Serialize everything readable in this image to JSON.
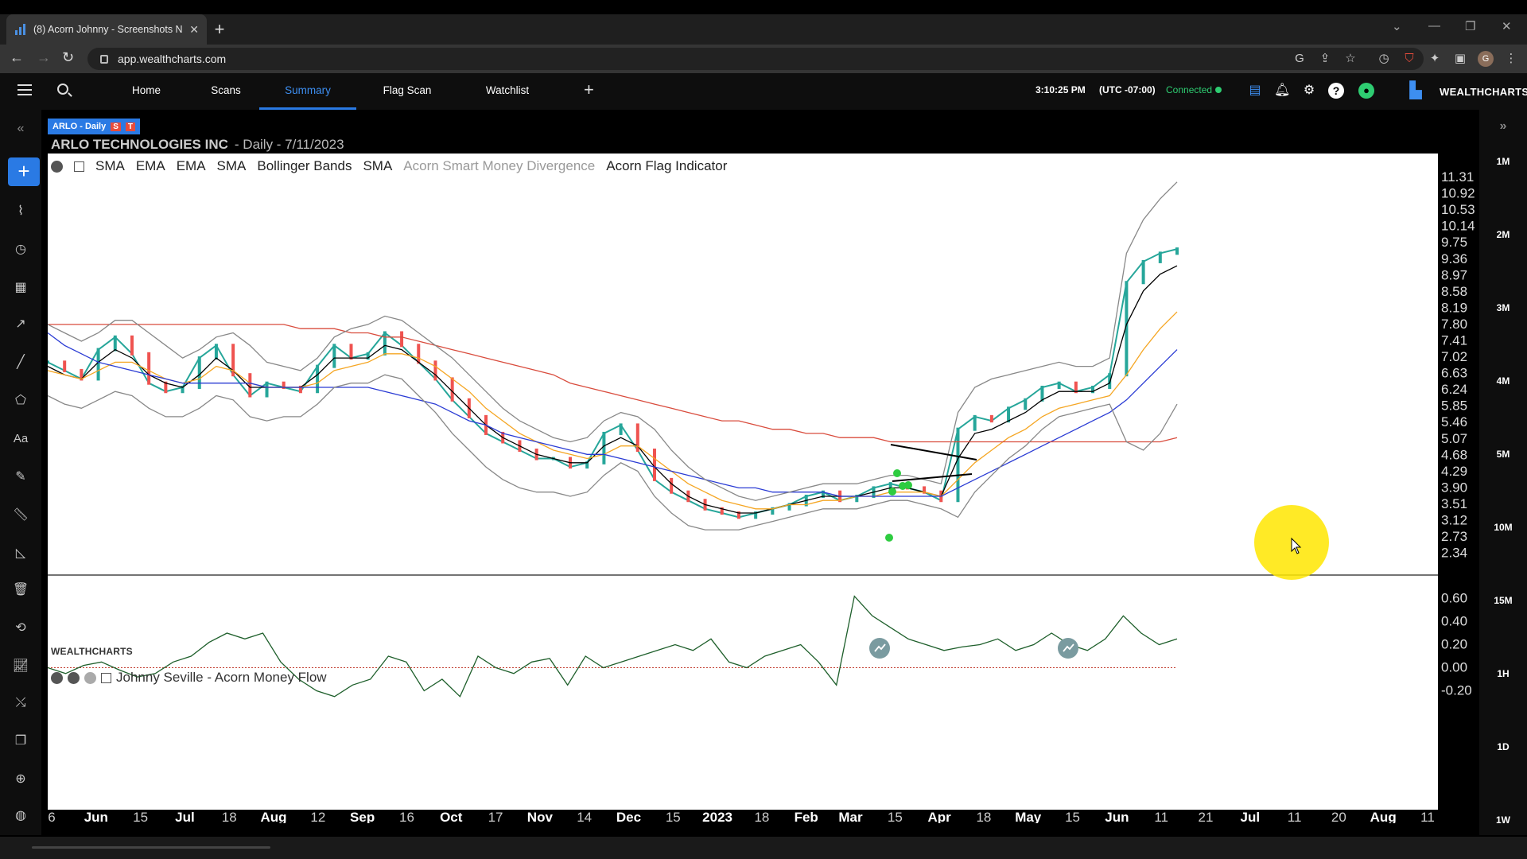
{
  "browser": {
    "tab_title": "(8) Acorn Johnny - Screenshots N",
    "url": "app.wealthcharts.com"
  },
  "header": {
    "nav_tabs": [
      "Home",
      "Scans",
      "Summary",
      "Flag Scan",
      "Watchlist"
    ],
    "active_tab": "Summary",
    "time": "3:10:25 PM",
    "timezone": "(UTC -07:00)",
    "status": "Connected",
    "brand": "WEALTHCHARTS"
  },
  "chart": {
    "symbol_badge": "ARLO - Daily",
    "badge_s": "S",
    "badge_t": "T",
    "company": "ARLO TECHNOLOGIES INC",
    "subtitle": "- Daily - 7/11/2023",
    "indicators": [
      "SMA",
      "EMA",
      "EMA",
      "SMA",
      "Bollinger Bands",
      "SMA"
    ],
    "indicator_dim": "Acorn Smart Money Divergence",
    "indicator_flag": "Acorn Flag Indicator",
    "watermark": "WEALTHCHARTS",
    "lower_panel_title": "Johnny Seville - Acorn Money Flow"
  },
  "timeframes": [
    "1M",
    "2M",
    "3M",
    "4M",
    "5M",
    "10M",
    "15M",
    "1H",
    "1D",
    "1W"
  ],
  "chart_data": {
    "type": "line",
    "title": "ARLO TECHNOLOGIES INC - Daily - 7/11/2023",
    "price_axis_ticks": [
      11.31,
      10.92,
      10.53,
      10.14,
      9.75,
      9.36,
      8.97,
      8.58,
      8.19,
      7.8,
      7.41,
      7.02,
      6.63,
      6.24,
      5.85,
      5.46,
      5.07,
      4.68,
      4.29,
      3.9,
      3.51,
      3.12,
      2.73,
      2.34
    ],
    "money_flow_axis_ticks": [
      "0.60",
      "0.40",
      "0.20",
      "0.00",
      "-0.20"
    ],
    "x_tick_labels": [
      "6",
      "Jun",
      "15",
      "Jul",
      "18",
      "Aug",
      "12",
      "Sep",
      "16",
      "Oct",
      "17",
      "Nov",
      "14",
      "Dec",
      "15",
      "2023",
      "18",
      "Feb",
      "Mar",
      "15",
      "Apr",
      "18",
      "May",
      "15",
      "Jun",
      "11",
      "21",
      "Jul",
      "11",
      "20",
      "Aug",
      "11"
    ],
    "ylim": [
      2.2,
      11.5
    ],
    "money_flow_ylim": [
      -0.3,
      0.7
    ],
    "series": [
      {
        "key": "price",
        "color": "#26a69a",
        "values": [
          6.9,
          6.7,
          6.5,
          7.2,
          7.5,
          7.1,
          6.4,
          6.2,
          6.3,
          7.0,
          7.3,
          6.6,
          6.1,
          6.4,
          6.3,
          6.2,
          6.8,
          7.3,
          7.0,
          7.1,
          7.6,
          7.3,
          6.9,
          6.5,
          6.0,
          5.6,
          5.2,
          5.0,
          4.8,
          4.6,
          4.6,
          4.4,
          4.5,
          5.2,
          5.4,
          4.8,
          4.1,
          3.8,
          3.6,
          3.4,
          3.3,
          3.2,
          3.3,
          3.4,
          3.5,
          3.7,
          3.8,
          3.6,
          3.7,
          3.9,
          4.0,
          3.9,
          3.8,
          3.6,
          5.3,
          5.6,
          5.5,
          5.8,
          6.0,
          6.3,
          6.4,
          6.2,
          6.3,
          6.6,
          8.8,
          9.3,
          9.5,
          9.6
        ]
      },
      {
        "key": "ema_fast",
        "color": "#000000",
        "values": [
          6.8,
          6.6,
          6.5,
          6.9,
          7.2,
          7.0,
          6.6,
          6.4,
          6.3,
          6.6,
          7.0,
          6.7,
          6.3,
          6.3,
          6.3,
          6.3,
          6.6,
          7.0,
          7.0,
          7.0,
          7.3,
          7.2,
          6.9,
          6.6,
          6.2,
          5.8,
          5.4,
          5.1,
          4.9,
          4.7,
          4.6,
          4.5,
          4.5,
          4.9,
          5.1,
          4.9,
          4.4,
          4.0,
          3.7,
          3.5,
          3.4,
          3.3,
          3.3,
          3.4,
          3.5,
          3.6,
          3.7,
          3.7,
          3.7,
          3.8,
          3.9,
          3.9,
          3.8,
          3.7,
          4.6,
          5.2,
          5.3,
          5.5,
          5.7,
          6.0,
          6.2,
          6.2,
          6.2,
          6.4,
          7.8,
          8.6,
          9.0,
          9.2
        ]
      },
      {
        "key": "ema_mid",
        "color": "#f5a623",
        "values": [
          6.7,
          6.6,
          6.5,
          6.7,
          6.9,
          6.9,
          6.7,
          6.5,
          6.4,
          6.5,
          6.8,
          6.7,
          6.4,
          6.3,
          6.3,
          6.3,
          6.4,
          6.7,
          6.8,
          6.9,
          7.1,
          7.1,
          7.0,
          6.8,
          6.5,
          6.2,
          5.8,
          5.5,
          5.2,
          5.0,
          4.8,
          4.7,
          4.6,
          4.7,
          4.9,
          4.9,
          4.6,
          4.3,
          4.0,
          3.8,
          3.6,
          3.5,
          3.4,
          3.4,
          3.5,
          3.5,
          3.6,
          3.6,
          3.7,
          3.7,
          3.8,
          3.8,
          3.8,
          3.7,
          4.1,
          4.5,
          4.8,
          5.1,
          5.3,
          5.6,
          5.8,
          5.9,
          6.0,
          6.1,
          6.6,
          7.2,
          7.7,
          8.1
        ]
      },
      {
        "key": "sma_blue",
        "color": "#2a3bd4",
        "values": [
          7.6,
          7.3,
          7.1,
          6.9,
          6.8,
          6.7,
          6.6,
          6.5,
          6.4,
          6.4,
          6.4,
          6.4,
          6.4,
          6.3,
          6.3,
          6.3,
          6.3,
          6.3,
          6.3,
          6.3,
          6.2,
          6.1,
          6.0,
          5.9,
          5.7,
          5.5,
          5.4,
          5.2,
          5.1,
          5.0,
          4.9,
          4.8,
          4.7,
          4.7,
          4.6,
          4.5,
          4.4,
          4.3,
          4.2,
          4.1,
          4.0,
          3.9,
          3.9,
          3.8,
          3.8,
          3.8,
          3.8,
          3.7,
          3.7,
          3.7,
          3.7,
          3.7,
          3.7,
          3.7,
          3.9,
          4.1,
          4.3,
          4.5,
          4.7,
          4.9,
          5.1,
          5.3,
          5.5,
          5.7,
          6.0,
          6.4,
          6.8,
          7.2
        ]
      },
      {
        "key": "sma_red",
        "color": "#d94c3d",
        "values": [
          7.8,
          7.8,
          7.8,
          7.8,
          7.8,
          7.8,
          7.8,
          7.8,
          7.8,
          7.8,
          7.8,
          7.8,
          7.8,
          7.8,
          7.8,
          7.7,
          7.7,
          7.7,
          7.6,
          7.6,
          7.5,
          7.5,
          7.4,
          7.3,
          7.2,
          7.1,
          7.0,
          6.9,
          6.8,
          6.7,
          6.6,
          6.4,
          6.3,
          6.2,
          6.1,
          6.0,
          5.9,
          5.8,
          5.7,
          5.6,
          5.5,
          5.5,
          5.4,
          5.3,
          5.3,
          5.2,
          5.2,
          5.1,
          5.1,
          5.1,
          5.0,
          5.0,
          5.0,
          5.0,
          5.0,
          5.0,
          5.0,
          5.0,
          5.0,
          5.0,
          5.0,
          5.0,
          5.0,
          5.0,
          5.0,
          5.0,
          5.0,
          5.1
        ]
      },
      {
        "key": "bb_upper",
        "color": "#888888",
        "values": [
          7.8,
          7.6,
          7.4,
          7.6,
          7.9,
          7.9,
          7.6,
          7.3,
          7.0,
          7.2,
          7.5,
          7.6,
          7.3,
          6.9,
          6.8,
          6.7,
          7.0,
          7.5,
          7.7,
          7.8,
          8.0,
          7.9,
          7.6,
          7.3,
          7.0,
          6.6,
          6.2,
          5.8,
          5.5,
          5.3,
          5.1,
          5.0,
          5.1,
          5.5,
          5.7,
          5.6,
          5.3,
          4.8,
          4.4,
          4.1,
          3.9,
          3.7,
          3.6,
          3.7,
          3.8,
          3.9,
          4.0,
          4.0,
          4.0,
          4.1,
          4.2,
          4.2,
          4.1,
          4.0,
          5.7,
          6.3,
          6.5,
          6.6,
          6.7,
          6.8,
          6.9,
          6.8,
          6.8,
          7.0,
          9.5,
          10.3,
          10.8,
          11.2
        ]
      },
      {
        "key": "bb_lower",
        "color": "#888888",
        "values": [
          6.1,
          5.9,
          5.8,
          6.0,
          6.2,
          6.1,
          5.8,
          5.6,
          5.6,
          5.8,
          6.1,
          6.0,
          5.6,
          5.5,
          5.6,
          5.6,
          5.9,
          6.3,
          6.4,
          6.4,
          6.6,
          6.5,
          6.1,
          5.7,
          5.2,
          4.8,
          4.4,
          4.1,
          3.9,
          3.8,
          3.8,
          3.7,
          3.8,
          4.2,
          4.5,
          4.3,
          3.7,
          3.3,
          3.0,
          2.9,
          2.9,
          2.9,
          3.0,
          3.1,
          3.2,
          3.3,
          3.4,
          3.4,
          3.4,
          3.5,
          3.6,
          3.6,
          3.5,
          3.4,
          3.2,
          3.8,
          4.2,
          4.6,
          4.9,
          5.3,
          5.6,
          5.7,
          5.8,
          5.9,
          5.0,
          4.8,
          5.2,
          5.9
        ]
      },
      {
        "key": "money_flow",
        "color": "#1e5f2b",
        "values": [
          0.0,
          -0.05,
          0.02,
          0.05,
          -0.02,
          -0.08,
          -0.05,
          0.05,
          0.1,
          0.22,
          0.3,
          0.25,
          0.3,
          0.05,
          -0.1,
          -0.2,
          -0.25,
          -0.15,
          -0.1,
          0.1,
          0.05,
          -0.2,
          -0.1,
          -0.25,
          0.1,
          0.0,
          -0.05,
          0.05,
          0.08,
          -0.15,
          0.1,
          0.0,
          0.05,
          0.1,
          0.15,
          0.2,
          0.15,
          0.25,
          0.05,
          0.0,
          0.1,
          0.15,
          0.2,
          0.05,
          -0.15,
          0.62,
          0.45,
          0.35,
          0.25,
          0.2,
          0.15,
          0.18,
          0.2,
          0.25,
          0.15,
          0.2,
          0.3,
          0.2,
          0.15,
          0.25,
          0.45,
          0.3,
          0.2,
          0.25
        ]
      }
    ]
  }
}
